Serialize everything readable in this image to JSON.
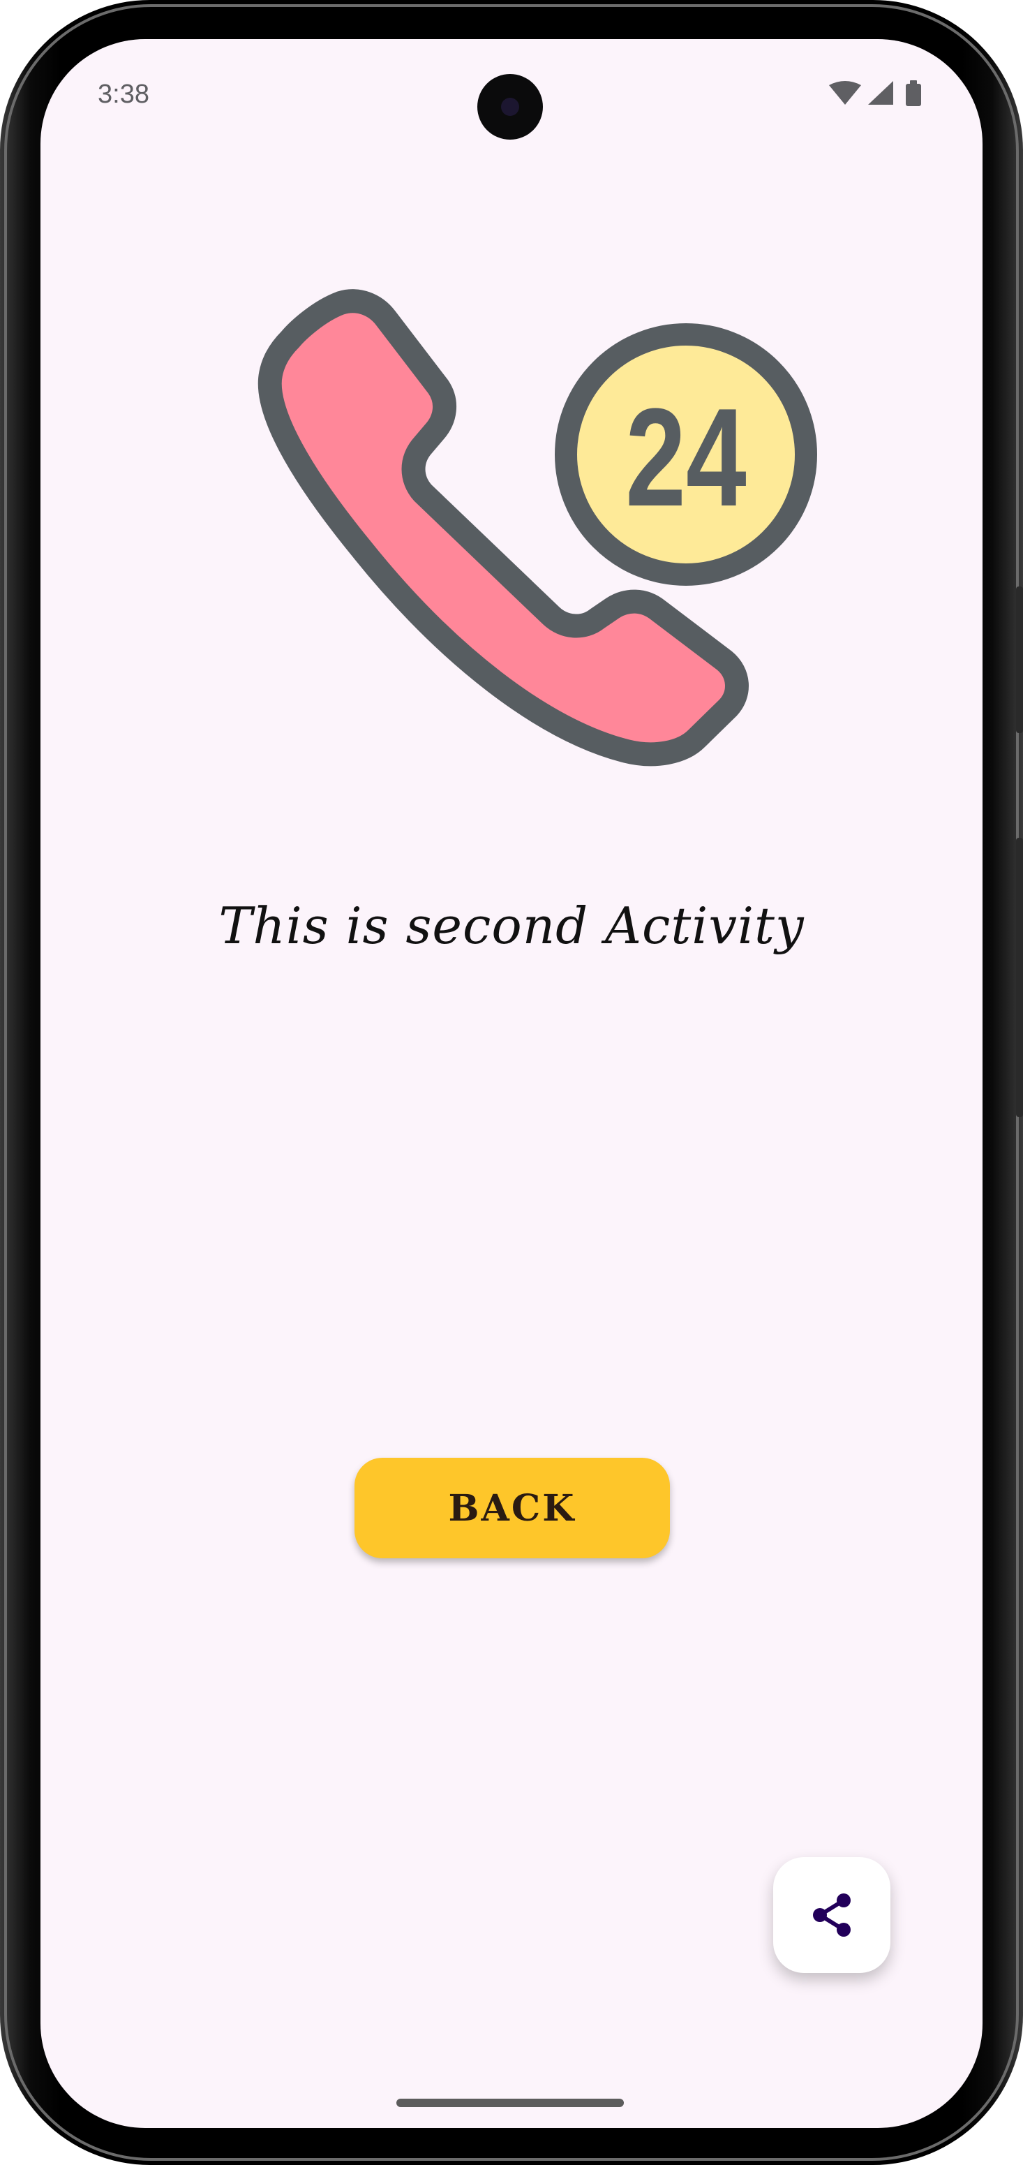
{
  "status_bar": {
    "time": "3:38",
    "icons": [
      "wifi-icon",
      "cell-signal-icon",
      "battery-icon"
    ]
  },
  "hero": {
    "icon": "phone-24-hours-icon",
    "badge_text": "24",
    "colors": {
      "handset_fill": "#ff8799",
      "outline": "#575d61",
      "badge_fill": "#feea98"
    }
  },
  "main": {
    "message": "This is second Activity",
    "back_label": "BACK",
    "back_color": "#fec62a"
  },
  "fab": {
    "icon": "share-icon",
    "icon_color": "#22005a"
  },
  "theme": {
    "background": "#fcf4fb"
  }
}
